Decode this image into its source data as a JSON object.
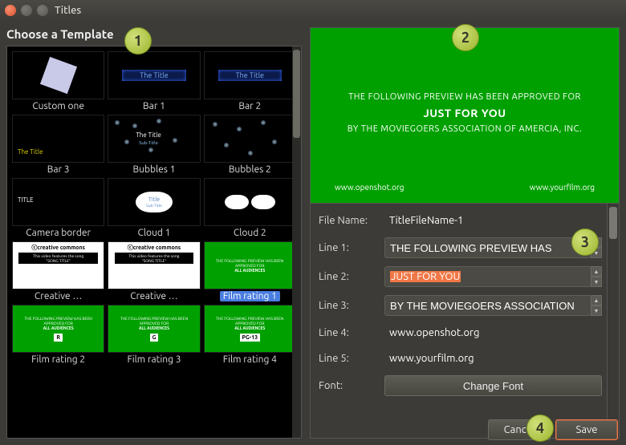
{
  "window": {
    "title": "Titles"
  },
  "left": {
    "heading": "Choose a Template",
    "templates": [
      {
        "label": "Custom one"
      },
      {
        "label": "Bar 1"
      },
      {
        "label": "Bar 2"
      },
      {
        "label": "Bar 3"
      },
      {
        "label": "Bubbles 1"
      },
      {
        "label": "Bubbles 2"
      },
      {
        "label": "Camera border"
      },
      {
        "label": "Cloud 1"
      },
      {
        "label": "Cloud 2"
      },
      {
        "label": "Creative …"
      },
      {
        "label": "Creative …"
      },
      {
        "label": "Film rating 1",
        "selected": true
      },
      {
        "label": "Film rating 2"
      },
      {
        "label": "Film rating 3"
      },
      {
        "label": "Film rating 4"
      }
    ]
  },
  "preview": {
    "line1": "THE FOLLOWING PREVIEW HAS BEEN APPROVED FOR",
    "line2": "JUST FOR YOU",
    "line3": "BY THE MOVIEGOERS ASSOCIATION OF AMERCIA, INC.",
    "line4": "www.openshot.org",
    "line5": "www.yourfilm.org"
  },
  "form": {
    "labels": {
      "filename": "File Name:",
      "line1": "Line 1:",
      "line2": "Line 2:",
      "line3": "Line 3:",
      "line4": "Line 4:",
      "line5": "Line 5:",
      "font": "Font:"
    },
    "values": {
      "filename": "TitleFileName-1",
      "line1": "THE FOLLOWING PREVIEW HAS",
      "line2": "JUST FOR YOU",
      "line3": "BY THE MOVIEGOERS ASSOCIATION",
      "line4": "www.openshot.org",
      "line5": "www.yourfilm.org",
      "font_button": "Change Font"
    }
  },
  "footer": {
    "cancel": "Cancel",
    "save": "Save"
  },
  "callouts": {
    "c1": "1",
    "c2": "2",
    "c3": "3",
    "c4": "4"
  },
  "thumb_text": {
    "bar_title": "The Title",
    "bubbles_main": "The Title",
    "bubbles_sub": "Sub-Title",
    "cam_title": "TITLE",
    "cloud_title": "Title",
    "cloud_sub": "Sub-Title",
    "cc_logo": "ⓒcreative commons",
    "cc_feat": "This video features the song",
    "cc_song": "\"SONG TITLE\"",
    "gc_line": "THE FOLLOWING PREVIEW HAS BEEN APPROVED FOR",
    "gc_aud": "ALL AUDIENCES",
    "r": "R",
    "g": "G",
    "pg": "PG-13"
  }
}
